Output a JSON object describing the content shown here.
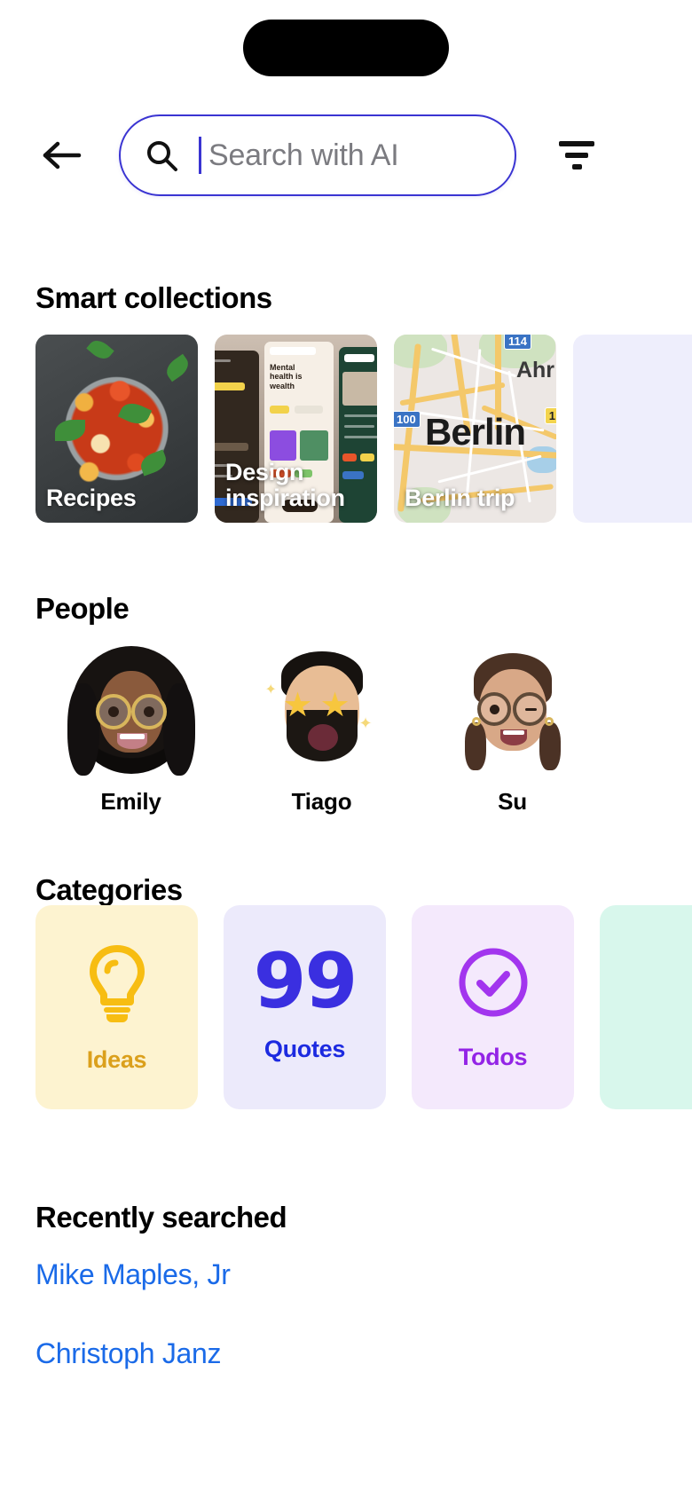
{
  "header": {
    "back_icon": "arrow-left-icon",
    "filter_icon": "filter-icon"
  },
  "search": {
    "placeholder": "Search with AI",
    "value": "",
    "icon": "search-icon",
    "border_color": "#3a34d2",
    "caret_color": "#3a34d2"
  },
  "smart_collections": {
    "title": "Smart collections",
    "cards": [
      {
        "label": "Recipes",
        "art": "food-photo"
      },
      {
        "label": "Design\ninspiration",
        "art": "design-screens"
      },
      {
        "label": "Berlin trip",
        "art": "map",
        "map_city": "Berlin",
        "map_town": "Ahr",
        "map_shield_1": "114",
        "map_shield_2": "100",
        "map_shield_3": "1"
      },
      {
        "label": "",
        "art": "placeholder"
      }
    ]
  },
  "people": {
    "title": "People",
    "items": [
      {
        "name": "Emily",
        "avatar": "memoji-emily"
      },
      {
        "name": "Tiago",
        "avatar": "memoji-tiago"
      },
      {
        "name": "Su",
        "avatar": "memoji-su"
      }
    ]
  },
  "categories": {
    "title": "Categories",
    "items": [
      {
        "label": "Ideas",
        "icon": "lightbulb-icon",
        "bg": "#fdf3d0",
        "color": "#f0ba16"
      },
      {
        "label": "Quotes",
        "icon": "quote-marks-icon",
        "bg": "#eceafb",
        "color": "#3a2fe0",
        "glyph": "99"
      },
      {
        "label": "Todos",
        "icon": "check-circle-icon",
        "bg": "#f4e9fc",
        "color": "#a235ee"
      },
      {
        "label": "",
        "icon": "",
        "bg": "#d8f7ec",
        "color": "#21b892"
      }
    ]
  },
  "recently_searched": {
    "title": "Recently searched",
    "items": [
      "Mike Maples, Jr",
      "Christoph Janz"
    ],
    "link_color": "#1a6ae8"
  }
}
